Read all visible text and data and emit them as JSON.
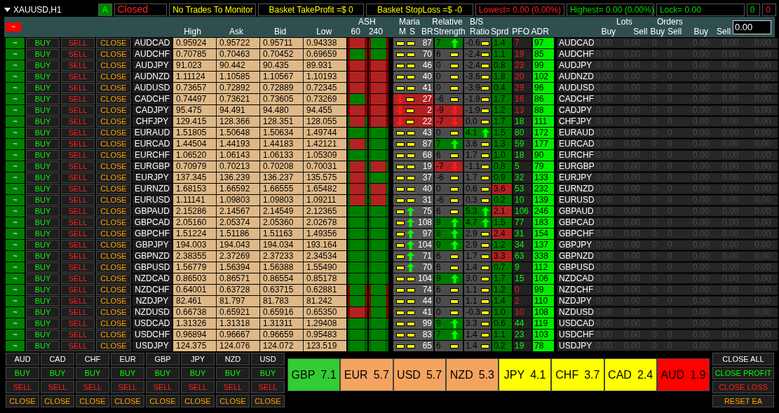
{
  "top_bar": {
    "symbol": "XAUUSD,H1",
    "auto_button": "A",
    "status": "Closed",
    "monitor": "No Trades To Monitor",
    "take_profit": "Basket TakeProfit =$ 0",
    "stop_loss": "Basket StopLoss =$ -0",
    "lowest": "Lowest= 0.00 (0.00%)",
    "highest": "Highest= 0.00 (0.00%)",
    "lock": "Lock= 0.00",
    "count_buy": "0",
    "count_sell": "0"
  },
  "header": {
    "toggle": "~",
    "high": "High",
    "ask": "Ask",
    "bid": "Bid",
    "low": "Low",
    "ash": "ASH",
    "ash60": "60",
    "ash240": "240",
    "maria": "Maria",
    "maria_m": "M",
    "maria_s": "S",
    "maria_br": "BR",
    "rs_1": "Relative",
    "rs_2": "Strength",
    "bs_1": "B/S",
    "bs_2": "Ratio",
    "sprd": "Sprd",
    "pfo": "PFO",
    "adr": "ADR",
    "lots": "Lots",
    "lots_buy": "Buy",
    "lots_sell": "Sell",
    "orders": "Orders",
    "orders_buy": "Buy",
    "orders_sell": "Sell",
    "profit_buy": "Buy",
    "profit_sell": "Sell",
    "input_value": "0.00"
  },
  "rows": [
    {
      "toggle": "~",
      "buy": "BUY",
      "sell": "SELL",
      "close": "CLOSE",
      "pair": "AUDCAD",
      "high": "0.95924",
      "ask": "0.95722",
      "bid": "0.95711",
      "low": "0.94338",
      "ash60": {
        "outer_up": false,
        "inner_up": false
      },
      "ash240": {
        "outer_up": false,
        "inner_up": true
      },
      "m": {
        "kind": "flat"
      },
      "s": {
        "kind": "flat"
      },
      "br": "87",
      "rs": {
        "value": "7",
        "kind": "up"
      },
      "bs": {
        "value": "-0.6",
        "kind": "flat"
      },
      "sprd": "1.4",
      "sprd_high": false,
      "pfo": "7",
      "pfo_positive": false,
      "adr": "97",
      "pair_2": "AUDCAD",
      "values": [
        "0.00",
        "0.00",
        "0",
        "0",
        "0.00",
        "0.00",
        "0.00"
      ]
    },
    {
      "toggle": "~",
      "buy": "BUY",
      "sell": "SELL",
      "close": "CLOSE",
      "pair": "AUDCHF",
      "high": "0.70785",
      "ask": "0.70463",
      "bid": "0.70452",
      "low": "0.69659",
      "ash60": {
        "outer_up": false,
        "inner_up": true
      },
      "ash240": {
        "outer_up": false,
        "inner_up": true
      },
      "m": {
        "kind": "flat"
      },
      "s": {
        "kind": "flat"
      },
      "br": "70",
      "rs": {
        "value": "6",
        "kind": "flat"
      },
      "bs": {
        "value": "-2.4",
        "kind": "flat"
      },
      "sprd": "1.1",
      "sprd_high": false,
      "pfo": "19",
      "pfo_positive": false,
      "adr": "85",
      "pair_2": "AUDCHF",
      "values": [
        "0.00",
        "0.00",
        "0",
        "0",
        "0.00",
        "0.00",
        "0.00"
      ]
    },
    {
      "toggle": "~",
      "buy": "BUY",
      "sell": "SELL",
      "close": "CLOSE",
      "pair": "AUDJPY",
      "high": "91.023",
      "ask": "90.442",
      "bid": "90.435",
      "low": "89.931",
      "ash60": {
        "outer_up": false,
        "inner_up": false
      },
      "ash240": {
        "outer_up": false,
        "inner_up": false
      },
      "m": {
        "kind": "flat"
      },
      "s": {
        "kind": "flat"
      },
      "br": "46",
      "rs": {
        "value": "0",
        "kind": "flat"
      },
      "bs": {
        "value": "-2.4",
        "kind": "flat"
      },
      "sprd": "0.8",
      "sprd_high": false,
      "pfo": "23",
      "pfo_positive": false,
      "adr": "99",
      "pair_2": "AUDJPY",
      "values": [
        "0.00",
        "0.00",
        "0",
        "0",
        "0.00",
        "0.00",
        "0.00"
      ]
    },
    {
      "toggle": "~",
      "buy": "BUY",
      "sell": "SELL",
      "close": "CLOSE",
      "pair": "AUDNZD",
      "high": "1.11124",
      "ask": "1.10585",
      "bid": "1.10567",
      "low": "1.10193",
      "ash60": {
        "outer_up": false,
        "inner_up": false
      },
      "ash240": {
        "outer_up": false,
        "inner_up": false
      },
      "m": {
        "kind": "flat"
      },
      "s": {
        "kind": "flat"
      },
      "br": "40",
      "rs": {
        "value": "0",
        "kind": "flat"
      },
      "bs": {
        "value": "-3.6",
        "kind": "flat"
      },
      "sprd": "1.8",
      "sprd_high": false,
      "pfo": "20",
      "pfo_positive": false,
      "adr": "102",
      "pair_2": "AUDNZD",
      "values": [
        "0.00",
        "0.00",
        "0",
        "0",
        "0.00",
        "0.00",
        "0.00"
      ]
    },
    {
      "toggle": "~",
      "buy": "BUY",
      "sell": "SELL",
      "close": "CLOSE",
      "pair": "AUDUSD",
      "high": "0.73657",
      "ask": "0.72892",
      "bid": "0.72889",
      "low": "0.72345",
      "ash60": {
        "outer_up": false,
        "inner_up": false
      },
      "ash240": {
        "outer_up": false,
        "inner_up": false
      },
      "m": {
        "kind": "flat"
      },
      "s": {
        "kind": "flat"
      },
      "br": "41",
      "rs": {
        "value": "0",
        "kind": "flat"
      },
      "bs": {
        "value": "-3.9",
        "kind": "flat"
      },
      "sprd": "0.4",
      "sprd_high": false,
      "pfo": "29",
      "pfo_positive": false,
      "adr": "96",
      "pair_2": "AUDUSD",
      "values": [
        "0.00",
        "0.00",
        "0",
        "0",
        "0.00",
        "0.00",
        "0.00"
      ]
    },
    {
      "toggle": "~",
      "buy": "BUY",
      "sell": "SELL",
      "close": "CLOSE",
      "pair": "CADCHF",
      "high": "0.74497",
      "ask": "0.73621",
      "bid": "0.73605",
      "low": "0.73269",
      "ash60": {
        "outer_up": false,
        "inner_up": true
      },
      "ash240": {
        "outer_up": false,
        "inner_up": false
      },
      "m": {
        "kind": "down"
      },
      "s": {
        "kind": "flat"
      },
      "br": "27",
      "rs": {
        "value": "-6",
        "kind": "flat"
      },
      "bs": {
        "value": "-1.9",
        "kind": "flat"
      },
      "sprd": "1.7",
      "sprd_high": false,
      "pfo": "16",
      "pfo_positive": false,
      "adr": "86",
      "pair_2": "CADCHF",
      "values": [
        "0.00",
        "0.00",
        "0",
        "0",
        "0.00",
        "0.00",
        "0.00"
      ]
    },
    {
      "toggle": "~",
      "buy": "BUY",
      "sell": "SELL",
      "close": "CLOSE",
      "pair": "CADJPY",
      "high": "95.475",
      "ask": "94.491",
      "bid": "94.480",
      "low": "94.455",
      "ash60": {
        "outer_up": false,
        "inner_up": false
      },
      "ash240": {
        "outer_up": false,
        "inner_up": false
      },
      "m": {
        "kind": "down"
      },
      "s": {
        "kind": "flat"
      },
      "br": "2",
      "rs": {
        "value": "-9",
        "kind": "down"
      },
      "bs": {
        "value": "-1.9",
        "kind": "flat"
      },
      "sprd": "1.2",
      "sprd_high": false,
      "pfo": "13",
      "pfo_positive": false,
      "adr": "88",
      "pair_2": "CADJPY",
      "values": [
        "0.00",
        "0.00",
        "0",
        "0",
        "0.00",
        "0.00",
        "0.00"
      ]
    },
    {
      "toggle": "~",
      "buy": "BUY",
      "sell": "SELL",
      "close": "CLOSE",
      "pair": "CHFJPY",
      "high": "129.415",
      "ask": "128.366",
      "bid": "128.351",
      "low": "128.055",
      "ash60": {
        "outer_up": true,
        "inner_up": false
      },
      "ash240": {
        "outer_up": false,
        "inner_up": false
      },
      "m": {
        "kind": "down"
      },
      "s": {
        "kind": "flat"
      },
      "br": "22",
      "rs": {
        "value": "-7",
        "kind": "down"
      },
      "bs": {
        "value": "0.0",
        "kind": "flat"
      },
      "sprd": "1.7",
      "sprd_high": false,
      "pfo": "18",
      "pfo_positive": true,
      "adr": "111",
      "pair_2": "CHFJPY",
      "values": [
        "0.00",
        "0.00",
        "0",
        "0",
        "0.00",
        "0.00",
        "0.00"
      ]
    },
    {
      "toggle": "~",
      "buy": "BUY",
      "sell": "SELL",
      "close": "CLOSE",
      "pair": "EURAUD",
      "high": "1.51805",
      "ask": "1.50648",
      "bid": "1.50634",
      "low": "1.49744",
      "ash60": {
        "outer_up": true,
        "inner_up": true
      },
      "ash240": {
        "outer_up": true,
        "inner_up": true
      },
      "m": {
        "kind": "flat"
      },
      "s": {
        "kind": "flat"
      },
      "br": "43",
      "rs": {
        "value": "0",
        "kind": "flat"
      },
      "bs": {
        "value": "4.1",
        "kind": "up"
      },
      "sprd": "1.5",
      "sprd_high": false,
      "pfo": "80",
      "pfo_positive": true,
      "adr": "172",
      "pair_2": "EURAUD",
      "values": [
        "0.00",
        "0.00",
        "0",
        "0",
        "0.00",
        "0.00",
        "0.00"
      ]
    },
    {
      "toggle": "~",
      "buy": "BUY",
      "sell": "SELL",
      "close": "CLOSE",
      "pair": "EURCAD",
      "high": "1.44504",
      "ask": "1.44193",
      "bid": "1.44183",
      "low": "1.42121",
      "ash60": {
        "outer_up": true,
        "inner_up": false
      },
      "ash240": {
        "outer_up": true,
        "inner_up": true
      },
      "m": {
        "kind": "flat"
      },
      "s": {
        "kind": "flat"
      },
      "br": "87",
      "rs": {
        "value": "7",
        "kind": "up"
      },
      "bs": {
        "value": "3.6",
        "kind": "flat"
      },
      "sprd": "1.3",
      "sprd_high": false,
      "pfo": "59",
      "pfo_positive": true,
      "adr": "177",
      "pair_2": "EURCAD",
      "values": [
        "0.00",
        "0.00",
        "0",
        "0",
        "0.00",
        "0.00",
        "0.00"
      ]
    },
    {
      "toggle": "~",
      "buy": "BUY",
      "sell": "SELL",
      "close": "CLOSE",
      "pair": "EURCHF",
      "high": "1.06520",
      "ask": "1.06143",
      "bid": "1.06133",
      "low": "1.05309",
      "ash60": {
        "outer_up": true,
        "inner_up": true
      },
      "ash240": {
        "outer_up": true,
        "inner_up": true
      },
      "m": {
        "kind": "flat"
      },
      "s": {
        "kind": "flat"
      },
      "br": "68",
      "rs": {
        "value": "6",
        "kind": "flat"
      },
      "bs": {
        "value": "1.7",
        "kind": "flat"
      },
      "sprd": "1.0",
      "sprd_high": false,
      "pfo": "18",
      "pfo_positive": true,
      "adr": "90",
      "pair_2": "EURCHF",
      "values": [
        "0.00",
        "0.00",
        "0",
        "0",
        "0.00",
        "0.00",
        "0.00"
      ]
    },
    {
      "toggle": "~",
      "buy": "BUY",
      "sell": "SELL",
      "close": "CLOSE",
      "pair": "EURGBP",
      "high": "0.70979",
      "ask": "0.70213",
      "bid": "0.70208",
      "low": "0.70031",
      "ash60": {
        "outer_up": true,
        "inner_up": false
      },
      "ash240": {
        "outer_up": true,
        "inner_up": false
      },
      "m": {
        "kind": "flat"
      },
      "s": {
        "kind": "flat"
      },
      "br": "19",
      "rs": {
        "value": "-7",
        "kind": "down"
      },
      "bs": {
        "value": "-1.1",
        "kind": "flat"
      },
      "sprd": "0.8",
      "sprd_high": false,
      "pfo": "5",
      "pfo_positive": true,
      "adr": "79",
      "pair_2": "EURGBP",
      "values": [
        "0.00",
        "0.00",
        "0",
        "0",
        "0.00",
        "0.00",
        "0.00"
      ]
    },
    {
      "toggle": "~",
      "buy": "BUY",
      "sell": "SELL",
      "close": "CLOSE",
      "pair": "EURJPY",
      "high": "137.345",
      "ask": "136.239",
      "bid": "136.237",
      "low": "135.575",
      "ash60": {
        "outer_up": true,
        "inner_up": false
      },
      "ash240": {
        "outer_up": true,
        "inner_up": true
      },
      "m": {
        "kind": "flat"
      },
      "s": {
        "kind": "flat"
      },
      "br": "37",
      "rs": {
        "value": "-6",
        "kind": "flat"
      },
      "bs": {
        "value": "1.7",
        "kind": "flat"
      },
      "sprd": "0.9",
      "sprd_high": false,
      "pfo": "32",
      "pfo_positive": true,
      "adr": "133",
      "pair_2": "EURJPY",
      "values": [
        "0.00",
        "0.00",
        "0",
        "0",
        "0.00",
        "0.00",
        "0.00"
      ]
    },
    {
      "toggle": "~",
      "buy": "BUY",
      "sell": "SELL",
      "close": "CLOSE",
      "pair": "EURNZD",
      "high": "1.68153",
      "ask": "1.66592",
      "bid": "1.66555",
      "low": "1.65482",
      "ash60": {
        "outer_up": true,
        "inner_up": false
      },
      "ash240": {
        "outer_up": true,
        "inner_up": false
      },
      "m": {
        "kind": "flat"
      },
      "s": {
        "kind": "flat"
      },
      "br": "40",
      "rs": {
        "value": "0",
        "kind": "flat"
      },
      "bs": {
        "value": "0.6",
        "kind": "flat"
      },
      "sprd": "3.6",
      "sprd_high": true,
      "pfo": "53",
      "pfo_positive": true,
      "adr": "232",
      "pair_2": "EURNZD",
      "values": [
        "0.00",
        "0.00",
        "0",
        "0",
        "0.00",
        "0.00",
        "0.00"
      ]
    },
    {
      "toggle": "~",
      "buy": "BUY",
      "sell": "SELL",
      "close": "CLOSE",
      "pair": "EURUSD",
      "high": "1.11141",
      "ask": "1.09803",
      "bid": "1.09803",
      "low": "1.09211",
      "ash60": {
        "outer_up": true,
        "inner_up": false
      },
      "ash240": {
        "outer_up": true,
        "inner_up": false
      },
      "m": {
        "kind": "flat"
      },
      "s": {
        "kind": "flat"
      },
      "br": "31",
      "rs": {
        "value": "-6",
        "kind": "flat"
      },
      "bs": {
        "value": "0.3",
        "kind": "flat"
      },
      "sprd": "0.2",
      "sprd_high": false,
      "pfo": "10",
      "pfo_positive": true,
      "adr": "139",
      "pair_2": "EURUSD",
      "values": [
        "0.00",
        "0.00",
        "0",
        "0",
        "0.00",
        "0.00",
        "0.00"
      ]
    },
    {
      "toggle": "~",
      "buy": "BUY",
      "sell": "SELL",
      "close": "CLOSE",
      "pair": "GBPAUD",
      "high": "2.15286",
      "ask": "2.14567",
      "bid": "2.14549",
      "low": "2.12365",
      "ash60": {
        "outer_up": true,
        "inner_up": true
      },
      "ash240": {
        "outer_up": true,
        "inner_up": true
      },
      "m": {
        "kind": "flat"
      },
      "s": {
        "kind": "up"
      },
      "br": "75",
      "rs": {
        "value": "6",
        "kind": "flat"
      },
      "bs": {
        "value": "5.3",
        "kind": "up"
      },
      "sprd": "2.1",
      "sprd_high": true,
      "pfo": "106",
      "pfo_positive": true,
      "adr": "246",
      "pair_2": "GBPAUD",
      "values": [
        "0.00",
        "0.00",
        "0",
        "0",
        "0.00",
        "0.00",
        "0.00"
      ]
    },
    {
      "toggle": "~",
      "buy": "BUY",
      "sell": "SELL",
      "close": "CLOSE",
      "pair": "GBPCAD",
      "high": "2.05160",
      "ask": "2.05374",
      "bid": "2.05360",
      "low": "2.02678",
      "ash60": {
        "outer_up": true,
        "inner_up": true
      },
      "ash240": {
        "outer_up": true,
        "inner_up": true
      },
      "m": {
        "kind": "flat"
      },
      "s": {
        "kind": "up"
      },
      "br": "108",
      "rs": {
        "value": "9",
        "kind": "up"
      },
      "bs": {
        "value": "4.7",
        "kind": "up"
      },
      "sprd": "1.5",
      "sprd_high": false,
      "pfo": "77",
      "pfo_positive": true,
      "adr": "183",
      "pair_2": "GBPCAD",
      "values": [
        "0.00",
        "0.00",
        "0",
        "0",
        "0.00",
        "0.00",
        "0.00"
      ]
    },
    {
      "toggle": "~",
      "buy": "BUY",
      "sell": "SELL",
      "close": "CLOSE",
      "pair": "GBPCHF",
      "high": "1.51224",
      "ask": "1.51186",
      "bid": "1.51163",
      "low": "1.49356",
      "ash60": {
        "outer_up": true,
        "inner_up": true
      },
      "ash240": {
        "outer_up": true,
        "inner_up": true
      },
      "m": {
        "kind": "flat"
      },
      "s": {
        "kind": "up"
      },
      "br": "97",
      "rs": {
        "value": "8",
        "kind": "up"
      },
      "bs": {
        "value": "2.9",
        "kind": "flat"
      },
      "sprd": "2.4",
      "sprd_high": true,
      "pfo": "31",
      "pfo_positive": true,
      "adr": "154",
      "pair_2": "GBPCHF",
      "values": [
        "0.00",
        "0.00",
        "0",
        "0",
        "0.00",
        "0.00",
        "0.00"
      ]
    },
    {
      "toggle": "~",
      "buy": "BUY",
      "sell": "SELL",
      "close": "CLOSE",
      "pair": "GBPJPY",
      "high": "194.003",
      "ask": "194.043",
      "bid": "194.034",
      "low": "193.164",
      "ash60": {
        "outer_up": true,
        "inner_up": true
      },
      "ash240": {
        "outer_up": true,
        "inner_up": true
      },
      "m": {
        "kind": "flat"
      },
      "s": {
        "kind": "up"
      },
      "br": "104",
      "rs": {
        "value": "9",
        "kind": "up"
      },
      "bs": {
        "value": "2.9",
        "kind": "flat"
      },
      "sprd": "1.2",
      "sprd_high": false,
      "pfo": "34",
      "pfo_positive": true,
      "adr": "137",
      "pair_2": "GBPJPY",
      "values": [
        "0.00",
        "0.00",
        "0",
        "0",
        "0.00",
        "0.00",
        "0.00"
      ]
    },
    {
      "toggle": "~",
      "buy": "BUY",
      "sell": "SELL",
      "close": "CLOSE",
      "pair": "GBPNZD",
      "high": "2.38355",
      "ask": "2.37269",
      "bid": "2.37233",
      "low": "2.34534",
      "ash60": {
        "outer_up": true,
        "inner_up": true
      },
      "ash240": {
        "outer_up": true,
        "inner_up": true
      },
      "m": {
        "kind": "flat"
      },
      "s": {
        "kind": "up"
      },
      "br": "71",
      "rs": {
        "value": "6",
        "kind": "flat"
      },
      "bs": {
        "value": "1.7",
        "kind": "flat"
      },
      "sprd": "3.3",
      "sprd_high": true,
      "pfo": "63",
      "pfo_positive": true,
      "adr": "338",
      "pair_2": "GBPNZD",
      "values": [
        "0.00",
        "0.00",
        "0",
        "0",
        "0.00",
        "0.00",
        "0.00"
      ]
    },
    {
      "toggle": "~",
      "buy": "BUY",
      "sell": "SELL",
      "close": "CLOSE",
      "pair": "GBPUSD",
      "high": "1.56779",
      "ask": "1.56394",
      "bid": "1.56388",
      "low": "1.55490",
      "ash60": {
        "outer_up": true,
        "inner_up": true
      },
      "ash240": {
        "outer_up": true,
        "inner_up": true
      },
      "m": {
        "kind": "flat"
      },
      "s": {
        "kind": "up"
      },
      "br": "70",
      "rs": {
        "value": "6",
        "kind": "flat"
      },
      "bs": {
        "value": "1.4",
        "kind": "flat"
      },
      "sprd": "0.7",
      "sprd_high": false,
      "pfo": "9",
      "pfo_positive": true,
      "adr": "112",
      "pair_2": "GBPUSD",
      "values": [
        "0.00",
        "0.00",
        "0",
        "0",
        "0.00",
        "0.00",
        "0.00"
      ]
    },
    {
      "toggle": "~",
      "buy": "BUY",
      "sell": "SELL",
      "close": "CLOSE",
      "pair": "NZDCAD",
      "high": "0.86503",
      "ask": "0.86571",
      "bid": "0.86554",
      "low": "0.85178",
      "ash60": {
        "outer_up": true,
        "inner_up": true
      },
      "ash240": {
        "outer_up": true,
        "inner_up": true
      },
      "m": {
        "kind": "flat"
      },
      "s": {
        "kind": "flat"
      },
      "br": "104",
      "rs": {
        "value": "9",
        "kind": "up"
      },
      "bs": {
        "value": "3.0",
        "kind": "flat"
      },
      "sprd": "1.7",
      "sprd_high": false,
      "pfo": "15",
      "pfo_positive": true,
      "adr": "106",
      "pair_2": "NZDCAD",
      "values": [
        "0.00",
        "0.00",
        "0",
        "0",
        "0.00",
        "0.00",
        "0.00"
      ]
    },
    {
      "toggle": "~",
      "buy": "BUY",
      "sell": "SELL",
      "close": "CLOSE",
      "pair": "NZDCHF",
      "high": "0.64001",
      "ask": "0.63728",
      "bid": "0.63715",
      "low": "0.62881",
      "ash60": {
        "outer_up": false,
        "inner_up": true
      },
      "ash240": {
        "outer_up": false,
        "inner_up": true
      },
      "m": {
        "kind": "flat"
      },
      "s": {
        "kind": "flat"
      },
      "br": "74",
      "rs": {
        "value": "6",
        "kind": "flat"
      },
      "bs": {
        "value": "1.1",
        "kind": "flat"
      },
      "sprd": "1.2",
      "sprd_high": false,
      "pfo": "0",
      "pfo_positive": false,
      "adr": "99",
      "pair_2": "NZDCHF",
      "values": [
        "0.00",
        "0.00",
        "0",
        "0",
        "0.00",
        "0.00",
        "0.00"
      ]
    },
    {
      "toggle": "~",
      "buy": "BUY",
      "sell": "SELL",
      "close": "CLOSE",
      "pair": "NZDJPY",
      "high": "82.461",
      "ask": "81.797",
      "bid": "81.783",
      "low": "81.242",
      "ash60": {
        "outer_up": false,
        "inner_up": true
      },
      "ash240": {
        "outer_up": false,
        "inner_up": true
      },
      "m": {
        "kind": "flat"
      },
      "s": {
        "kind": "flat"
      },
      "br": "44",
      "rs": {
        "value": "0",
        "kind": "flat"
      },
      "bs": {
        "value": "1.1",
        "kind": "flat"
      },
      "sprd": "1.4",
      "sprd_high": false,
      "pfo": "2",
      "pfo_positive": false,
      "adr": "110",
      "pair_2": "NZDJPY",
      "values": [
        "0.00",
        "0.00",
        "0",
        "0",
        "0.00",
        "0.00",
        "0.00"
      ]
    },
    {
      "toggle": "~",
      "buy": "BUY",
      "sell": "SELL",
      "close": "CLOSE",
      "pair": "NZDUSD",
      "high": "0.66738",
      "ask": "0.65921",
      "bid": "0.65916",
      "low": "0.65350",
      "ash60": {
        "outer_up": false,
        "inner_up": false
      },
      "ash240": {
        "outer_up": false,
        "inner_up": true
      },
      "m": {
        "kind": "flat"
      },
      "s": {
        "kind": "flat"
      },
      "br": "41",
      "rs": {
        "value": "0",
        "kind": "flat"
      },
      "bs": {
        "value": "-0.3",
        "kind": "flat"
      },
      "sprd": "1.0",
      "sprd_high": false,
      "pfo": "10",
      "pfo_positive": false,
      "adr": "108",
      "pair_2": "NZDUSD",
      "values": [
        "0.00",
        "0.00",
        "0",
        "0",
        "0.00",
        "0.00",
        "0.00"
      ]
    },
    {
      "toggle": "~",
      "buy": "BUY",
      "sell": "SELL",
      "close": "CLOSE",
      "pair": "USDCAD",
      "high": "1.31326",
      "ask": "1.31318",
      "bid": "1.31311",
      "low": "1.29408",
      "ash60": {
        "outer_up": true,
        "inner_up": true
      },
      "ash240": {
        "outer_up": true,
        "inner_up": true
      },
      "m": {
        "kind": "flat"
      },
      "s": {
        "kind": "flat"
      },
      "br": "99",
      "rs": {
        "value": "9",
        "kind": "up"
      },
      "bs": {
        "value": "3.3",
        "kind": "flat"
      },
      "sprd": "0.6",
      "sprd_high": false,
      "pfo": "44",
      "pfo_positive": true,
      "adr": "119",
      "pair_2": "USDCAD",
      "values": [
        "0.00",
        "0.00",
        "0",
        "0",
        "0.00",
        "0.00",
        "0.00"
      ]
    },
    {
      "toggle": "~",
      "buy": "BUY",
      "sell": "SELL",
      "close": "CLOSE",
      "pair": "USDCHF",
      "high": "0.96894",
      "ask": "0.96667",
      "bid": "0.96659",
      "low": "0.95483",
      "ash60": {
        "outer_up": true,
        "inner_up": true
      },
      "ash240": {
        "outer_up": true,
        "inner_up": true
      },
      "m": {
        "kind": "flat"
      },
      "s": {
        "kind": "flat"
      },
      "br": "83",
      "rs": {
        "value": "7",
        "kind": "up"
      },
      "bs": {
        "value": "1.4",
        "kind": "flat"
      },
      "sprd": "1.1",
      "sprd_high": false,
      "pfo": "23",
      "pfo_positive": true,
      "adr": "103",
      "pair_2": "USDCHF",
      "values": [
        "0.00",
        "0.00",
        "0",
        "0",
        "0.00",
        "0.00",
        "0.00"
      ]
    },
    {
      "toggle": "~",
      "buy": "BUY",
      "sell": "SELL",
      "close": "CLOSE",
      "pair": "USDJPY",
      "high": "124.375",
      "ask": "124.076",
      "bid": "124.072",
      "low": "123.519",
      "ash60": {
        "outer_up": true,
        "inner_up": true
      },
      "ash240": {
        "outer_up": true,
        "inner_up": true
      },
      "m": {
        "kind": "flat"
      },
      "s": {
        "kind": "flat"
      },
      "br": "65",
      "rs": {
        "value": "6",
        "kind": "flat"
      },
      "bs": {
        "value": "1.4",
        "kind": "flat"
      },
      "sprd": "0.2",
      "sprd_high": false,
      "pfo": "19",
      "pfo_positive": true,
      "adr": "78",
      "pair_2": "USDJPY",
      "values": [
        "0.00",
        "0.00",
        "0",
        "0",
        "0.00",
        "0.00",
        "0.00"
      ]
    }
  ],
  "currency_panel": [
    {
      "currency": "AUD",
      "buy": "BUY",
      "sell": "SELL",
      "close": "CLOSE"
    },
    {
      "currency": "CAD",
      "buy": "BUY",
      "sell": "SELL",
      "close": "CLOSE"
    },
    {
      "currency": "CHF",
      "buy": "BUY",
      "sell": "SELL",
      "close": "CLOSE"
    },
    {
      "currency": "EUR",
      "buy": "BUY",
      "sell": "SELL",
      "close": "CLOSE"
    },
    {
      "currency": "GBP",
      "buy": "BUY",
      "sell": "SELL",
      "close": "CLOSE"
    },
    {
      "currency": "JPY",
      "buy": "BUY",
      "sell": "SELL",
      "close": "CLOSE"
    },
    {
      "currency": "NZD",
      "buy": "BUY",
      "sell": "SELL",
      "close": "CLOSE"
    },
    {
      "currency": "USD",
      "buy": "BUY",
      "sell": "SELL",
      "close": "CLOSE"
    }
  ],
  "strength_bar": [
    {
      "currency": "GBP",
      "value": "7.1",
      "color": "#33cc33"
    },
    {
      "currency": "EUR",
      "value": "5.7",
      "color": "#f4a460"
    },
    {
      "currency": "USD",
      "value": "5.7",
      "color": "#f4a460"
    },
    {
      "currency": "NZD",
      "value": "5.3",
      "color": "#f4a460"
    },
    {
      "currency": "JPY",
      "value": "4.1",
      "color": "#ffff00"
    },
    {
      "currency": "CHF",
      "value": "3.7",
      "color": "#ffff00"
    },
    {
      "currency": "CAD",
      "value": "2.4",
      "color": "#ffff00"
    },
    {
      "currency": "AUD",
      "value": "1.9",
      "color": "#ff0000"
    }
  ],
  "actions": [
    {
      "label": "CLOSE ALL",
      "kind": "neutral"
    },
    {
      "label": "CLOSE PROFIT",
      "kind": "profit"
    },
    {
      "label": "CLOSE LOSS",
      "kind": "loss"
    },
    {
      "label": "RESET EA",
      "kind": "reset"
    }
  ]
}
